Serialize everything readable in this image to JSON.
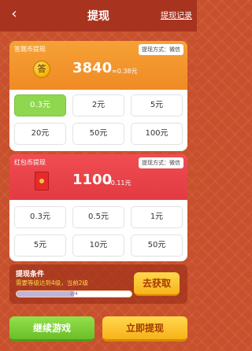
{
  "header": {
    "title": "提现",
    "record_link": "提现记录",
    "back_icon": "chevron-left-icon"
  },
  "coin_card": {
    "label": "答题币提现",
    "method": "提现方式：微信",
    "coin_glyph": "答",
    "amount": "3840",
    "approx": "≈0.38元",
    "options": [
      "0.3元",
      "2元",
      "5元",
      "20元",
      "50元",
      "100元"
    ],
    "selected_index": 0,
    "header_color": "#f08a24"
  },
  "red_card": {
    "label": "红包币提现",
    "method": "提现方式：微信",
    "amount": "1100",
    "approx": "≈0.11元",
    "options": [
      "0.3元",
      "0.5元",
      "1元",
      "5元",
      "10元",
      "50元"
    ],
    "header_color": "#e23a42"
  },
  "condition": {
    "title": "提现条件",
    "desc": "需要等级达到4级，当前2级",
    "progress_text": "2/4",
    "progress": 0.5,
    "obtain_label": "去获取"
  },
  "footer": {
    "continue_label": "继续游戏",
    "withdraw_label": "立即提现"
  },
  "colors": {
    "selected": "#8ed74e",
    "accent_yellow": "#f8b21a"
  }
}
